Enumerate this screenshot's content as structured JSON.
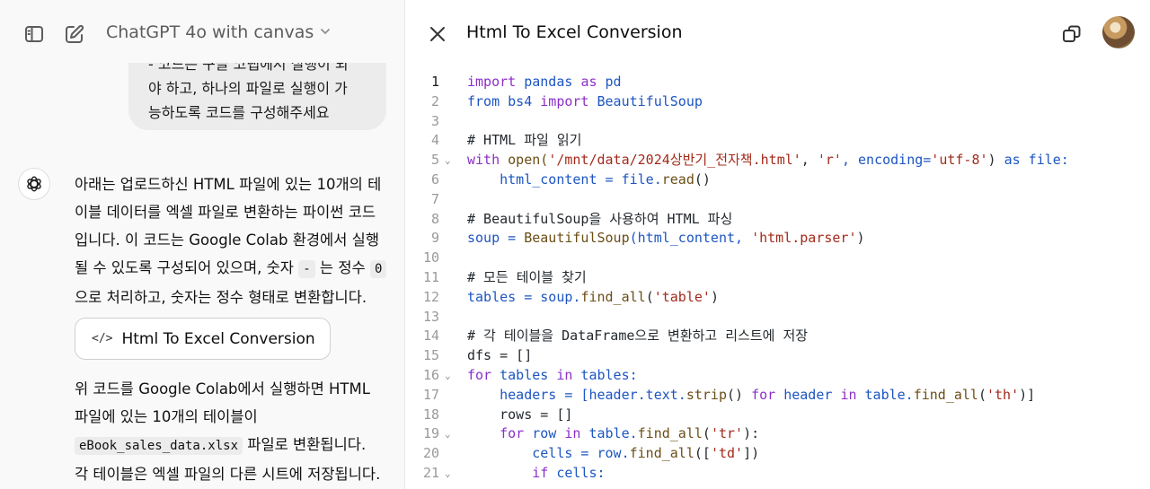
{
  "header": {
    "model_label": "ChatGPT 4o with canvas",
    "canvas_title": "Html To Excel Conversion"
  },
  "user_message": {
    "lines": [
      "- 코드는 구글 코랩에서 실행이 되",
      "야 하고, 하나의 파일로 실행이 가",
      "능하도록 코드를 구성해주세요"
    ]
  },
  "assistant": {
    "para1": {
      "line1": "아래는 업로드하신 HTML 파일에 있는 10개의 테",
      "line2": "이블 데이터를 엑셀 파일로 변환하는 파이썬 코드",
      "line3": "입니다. 이 코드는 Google Colab 환경에서 실행",
      "line4_a": "될 수 있도록 구성되어 있으며, 숫자 ",
      "line4_code1": "-",
      "line4_b": " 는 정수 ",
      "line4_code2": "0",
      "line5": "으로 처리하고, 숫자는 정수 형태로 변환합니다."
    },
    "canvas_card_label": "Html To Excel Conversion",
    "canvas_card_glyph": "</>",
    "para2": {
      "line1": "위 코드를 Google Colab에서 실행하면 HTML",
      "line2": "파일에 있는 10개의 테이블이",
      "line3_code": "eBook_sales_data.xlsx",
      "line3_b": " 파일로 변환됩니다.",
      "line4": "각 테이블은 엑셀 파일의 다른 시트에 저장됩니다."
    }
  },
  "code_lines": [
    {
      "n": "1",
      "fold": false
    },
    {
      "n": "2",
      "fold": false
    },
    {
      "n": "3",
      "fold": false
    },
    {
      "n": "4",
      "fold": false
    },
    {
      "n": "5",
      "fold": true
    },
    {
      "n": "6",
      "fold": false
    },
    {
      "n": "7",
      "fold": false
    },
    {
      "n": "8",
      "fold": false
    },
    {
      "n": "9",
      "fold": false
    },
    {
      "n": "10",
      "fold": false
    },
    {
      "n": "11",
      "fold": false
    },
    {
      "n": "12",
      "fold": false
    },
    {
      "n": "13",
      "fold": false
    },
    {
      "n": "14",
      "fold": false
    },
    {
      "n": "15",
      "fold": false
    },
    {
      "n": "16",
      "fold": true
    },
    {
      "n": "17",
      "fold": false
    },
    {
      "n": "18",
      "fold": false
    },
    {
      "n": "19",
      "fold": true
    },
    {
      "n": "20",
      "fold": false
    },
    {
      "n": "21",
      "fold": true
    }
  ],
  "code": {
    "l1": {
      "a": "import",
      "b": " pandas ",
      "c": "as",
      "d": " pd"
    },
    "l2": {
      "a": "from",
      "b": " bs4 ",
      "c": "import",
      "d": " BeautifulSoup"
    },
    "l4": "# HTML 파일 읽기",
    "l5": {
      "a": "with",
      "b": " open(",
      "c": "'/mnt/data/2024상반기_전자책.html'",
      "d": ", ",
      "e": "'r'",
      "f": ", encoding=",
      "g": "'utf-8'",
      "h": ") ",
      "i": "as",
      "j": " file:"
    },
    "l6": {
      "a": "    html_content = file.",
      "b": "read",
      "c": "()"
    },
    "l8": "# BeautifulSoup을 사용하여 HTML 파싱",
    "l9": {
      "a": "soup = ",
      "b": "BeautifulSoup",
      "c": "(html_content, ",
      "d": "'html.parser'",
      "e": ")"
    },
    "l11": "# 모든 테이블 찾기",
    "l12": {
      "a": "tables = soup.",
      "b": "find_all",
      "c": "(",
      "d": "'table'",
      "e": ")"
    },
    "l14": "# 각 테이블을 DataFrame으로 변환하고 리스트에 저장",
    "l15": {
      "a": "dfs = []"
    },
    "l16": {
      "a": "for",
      "b": " tables ",
      "c": "in",
      "d": " tables:"
    },
    "l17": {
      "a": "    headers = [header.text.",
      "b": "strip",
      "c": "() ",
      "d": "for",
      "e": " header ",
      "f": "in",
      "g": " table.",
      "h": "find_all",
      "i": "(",
      "j": "'th'",
      "k": ")]"
    },
    "l18": {
      "a": "    rows = []"
    },
    "l19": {
      "a": "    ",
      "b": "for",
      "c": " row ",
      "d": "in",
      "e": " table.",
      "f": "find_all",
      "g": "(",
      "h": "'tr'",
      "i": "):"
    },
    "l20": {
      "a": "        cells = row.",
      "b": "find_all",
      "c": "([",
      "d": "'td'",
      "e": "])"
    },
    "l21": {
      "a": "        ",
      "b": "if",
      "c": " cells:"
    }
  },
  "colors": {
    "keyword": "#8b2fc9",
    "keyword_blue": "#1d55c2",
    "function": "#6b4e16",
    "string": "#a32a1b",
    "comment": "#2f7d32"
  },
  "icons": [
    "sidebar-toggle-icon",
    "new-chat-icon",
    "chevron-down-icon",
    "openai-logo-icon",
    "code-icon",
    "close-icon",
    "copy-icon"
  ]
}
